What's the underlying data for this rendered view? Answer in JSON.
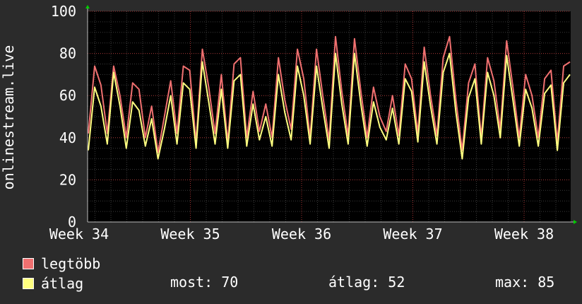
{
  "colors": {
    "background": "#2b2b2b",
    "plot_background": "#000000",
    "grid_major": "#a03030",
    "grid_minor": "#3a3a3a",
    "series_max": "#f07070",
    "series_avg": "#ffff80",
    "axis_arrow": "#00cc00",
    "text": "#ffffff"
  },
  "chart_data": {
    "type": "line",
    "ylabel": "onlinestream.live",
    "ylim": [
      0,
      100
    ],
    "yticks": [
      0,
      20,
      40,
      60,
      80,
      100
    ],
    "xticks": [
      "Week 34",
      "Week 35",
      "Week 36",
      "Week 37",
      "Week 38"
    ],
    "grid": true,
    "series": [
      {
        "name": "legtöbb",
        "color": "#f07070",
        "values": [
          42,
          74,
          65,
          42,
          74,
          60,
          40,
          66,
          63,
          40,
          55,
          33,
          50,
          67,
          42,
          74,
          72,
          38,
          82,
          64,
          42,
          70,
          38,
          75,
          78,
          40,
          62,
          43,
          56,
          40,
          78,
          58,
          44,
          82,
          68,
          40,
          82,
          60,
          39,
          88,
          62,
          41,
          87,
          62,
          40,
          64,
          50,
          43,
          60,
          41,
          75,
          68,
          42,
          83,
          60,
          41,
          78,
          88,
          58,
          34,
          66,
          75,
          40,
          78,
          67,
          44,
          86,
          64,
          40,
          70,
          60,
          40,
          68,
          72,
          38,
          74,
          76
        ]
      },
      {
        "name": "átlag",
        "color": "#ffff80",
        "values": [
          34,
          64,
          55,
          37,
          71,
          55,
          35,
          57,
          53,
          36,
          49,
          30,
          44,
          60,
          37,
          66,
          63,
          35,
          76,
          57,
          37,
          63,
          35,
          67,
          70,
          36,
          56,
          39,
          50,
          36,
          70,
          52,
          39,
          74,
          60,
          37,
          74,
          54,
          35,
          80,
          56,
          37,
          80,
          56,
          36,
          57,
          45,
          39,
          54,
          37,
          68,
          62,
          38,
          76,
          55,
          37,
          71,
          80,
          52,
          30,
          59,
          68,
          37,
          71,
          60,
          40,
          79,
          58,
          36,
          63,
          54,
          36,
          61,
          65,
          34,
          66,
          70
        ]
      }
    ]
  },
  "legend": {
    "items": [
      {
        "label": "legtöbb",
        "color": "#f07070"
      },
      {
        "label": "átlag",
        "color": "#ffff80"
      }
    ],
    "stats": {
      "now_label": "most: 70",
      "avg_label": "átlag: 52",
      "max_label": "max: 85"
    }
  }
}
